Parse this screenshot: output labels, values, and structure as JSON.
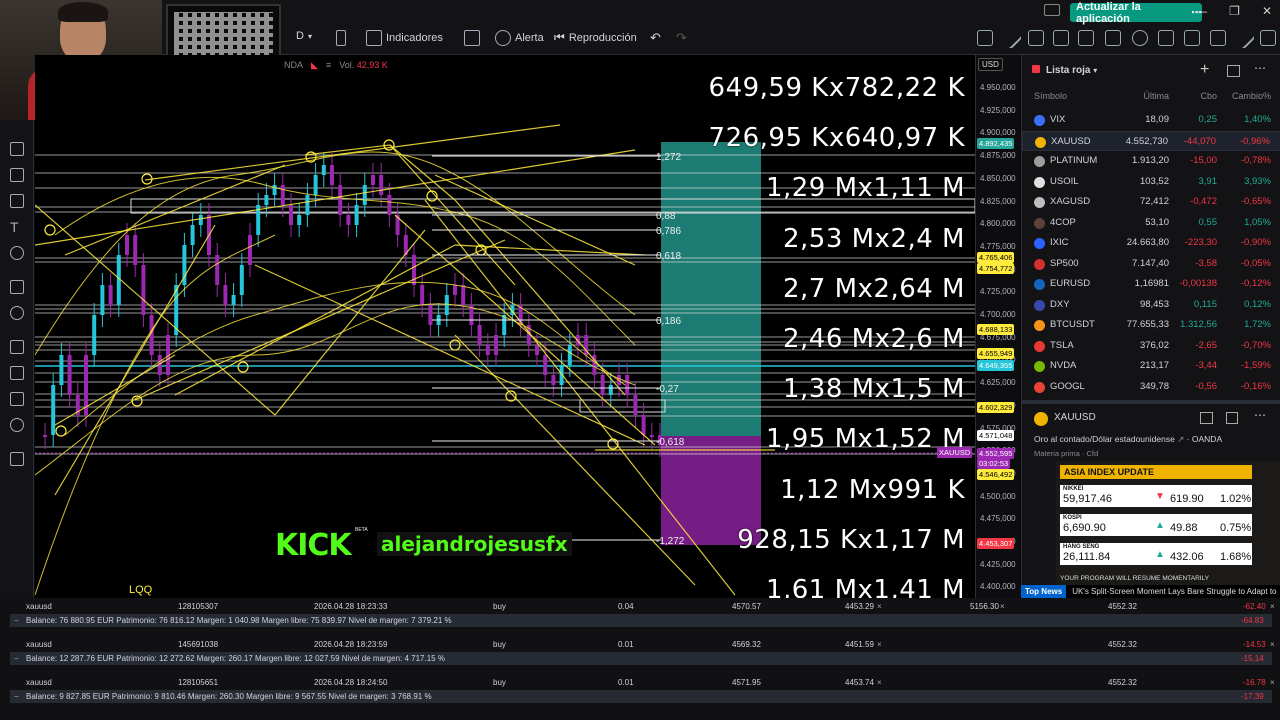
{
  "topbar": {
    "interval": "D",
    "indicators": "Indicadores",
    "alert": "Alerta",
    "replay": "Reproducción",
    "update_button": "Actualizar la aplicación"
  },
  "chart_header": {
    "broker": "NDA",
    "volume_label": "Vol.",
    "volume_value": "42,93 K"
  },
  "chart": {
    "fib_levels": [
      "1,272",
      "0,88",
      "0,786",
      "0,618",
      "0,186",
      "-0,27",
      "-0,618",
      "-1,272"
    ],
    "position_labels": [
      "649,59 Kx782,22 K",
      "726,95 Kx640,97 K",
      "1,29 Mx1,11 M",
      "2,53 Mx2,4 M",
      "2,7 Mx2,64 M",
      "2,46 Mx2,6 M",
      "1,38 Mx1,5 M",
      "1,95 Mx1,52 M",
      "1,12 Mx991 K",
      "928,15 Kx1,17 M",
      "1,61 Mx1,41 M"
    ],
    "kick_logo": "KICK",
    "kick_beta": "BETA",
    "kick_user": "alejandrojesusfx",
    "bottom_label": "LQQ"
  },
  "price_axis": {
    "currency": "USD",
    "ticks": [
      "4.950,000",
      "4.925,000",
      "4.900,000",
      "4.875,000",
      "4.850,000",
      "4.825,000",
      "4.800,000",
      "4.775,000",
      "4.750,000",
      "4.725,000",
      "4.700,000",
      "4.675,000",
      "4.650,000",
      "4.625,000",
      "4.600,000",
      "4.575,000",
      "4.550,000",
      "4.525,000",
      "4.500,000",
      "4.475,000",
      "4.450,000",
      "4.425,000",
      "4.400,000"
    ],
    "tags": {
      "t1": "4.892,435",
      "t2": "4.765,406",
      "t3": "4.754,772",
      "t4": "4.688,133",
      "t5": "4.655,949",
      "t6": "4.649,355",
      "t7": "4.602,329",
      "t8": "4.571,048",
      "t9": "4.552,595",
      "t9b": "03:02:53",
      "t10": "4.546,492",
      "t11": "4.453,307",
      "xau": "XAUUSD"
    }
  },
  "watchlist": {
    "title": "Lista roja",
    "headers": {
      "symbol": "Símbolo",
      "last": "Última",
      "chg": "Cbo",
      "pct": "Cambio%"
    },
    "rows": [
      {
        "sym": "VIX",
        "last": "18,09",
        "chg": "0,25",
        "pct": "1,40%",
        "dir": "pos",
        "color": "#3a6ff7"
      },
      {
        "sym": "XAUUSD",
        "last": "4.552,730",
        "chg": "-44,070",
        "pct": "-0,96%",
        "dir": "neg",
        "color": "#f0b400"
      },
      {
        "sym": "PLATINUM",
        "last": "1.913,20",
        "chg": "-15,00",
        "pct": "-0,78%",
        "dir": "neg",
        "color": "#9e9e9e"
      },
      {
        "sym": "USOIL",
        "last": "103,52",
        "chg": "3,91",
        "pct": "3,93%",
        "dir": "pos",
        "color": "#e0e0e0"
      },
      {
        "sym": "XAGUSD",
        "last": "72,412",
        "chg": "-0,472",
        "pct": "-0,65%",
        "dir": "neg",
        "color": "#bdbdbd"
      },
      {
        "sym": "4COP",
        "last": "53,10",
        "chg": "0,55",
        "pct": "1,05%",
        "dir": "pos",
        "color": "#5d4037"
      },
      {
        "sym": "IXIC",
        "last": "24.663,80",
        "chg": "-223,30",
        "pct": "-0,90%",
        "dir": "neg",
        "color": "#2962ff"
      },
      {
        "sym": "SP500",
        "last": "7.147,40",
        "chg": "-3,58",
        "pct": "-0,05%",
        "dir": "neg",
        "color": "#d32f2f"
      },
      {
        "sym": "EURUSD",
        "last": "1,16981",
        "chg": "-0,00138",
        "pct": "-0,12%",
        "dir": "neg",
        "color": "#1565c0"
      },
      {
        "sym": "DXY",
        "last": "98,453",
        "chg": "0,115",
        "pct": "0,12%",
        "dir": "pos",
        "color": "#3949ab"
      },
      {
        "sym": "BTCUSDT",
        "last": "77.655,33",
        "chg": "1.312,56",
        "pct": "1,72%",
        "dir": "pos",
        "color": "#f7931a"
      },
      {
        "sym": "TSLA",
        "last": "376,02",
        "chg": "-2,65",
        "pct": "-0,70%",
        "dir": "neg",
        "color": "#e53935"
      },
      {
        "sym": "NVDA",
        "last": "213,17",
        "chg": "-3,44",
        "pct": "-1,59%",
        "dir": "neg",
        "color": "#76b900"
      },
      {
        "sym": "GOOGL",
        "last": "349,78",
        "chg": "-0,56",
        "pct": "-0,16%",
        "dir": "neg",
        "color": "#ea4335"
      }
    ]
  },
  "detail": {
    "symbol": "XAUUSD",
    "description": "Oro al contado/Dólar estadounidense",
    "broker": "OANDA",
    "type": "Materia prima · Cfd"
  },
  "asia": {
    "title": "ASIA INDEX UPDATE",
    "rows": [
      {
        "name": "NIKKEI",
        "value": "59,917.46",
        "arrow": "▼",
        "delta": "619.90",
        "pct": "1.02%",
        "dir": "neg"
      },
      {
        "name": "KOSPI",
        "value": "6,690.90",
        "arrow": "▲",
        "delta": "49.88",
        "pct": "0.75%",
        "dir": "pos"
      },
      {
        "name": "HANG SENG",
        "value": "26,111.84",
        "arrow": "▲",
        "delta": "432.06",
        "pct": "1.68%",
        "dir": "pos"
      }
    ],
    "footer": "YOUR PROGRAM WILL RESUME MOMENTARILY"
  },
  "news": {
    "tag": "Top News",
    "text": "UK's Split-Screen Moment Lays Bare Struggle to Adapt to"
  },
  "trades": [
    {
      "symbol": "xauusd",
      "ticket": "128105307",
      "time": "2026.04.28 18:23:33",
      "type": "buy",
      "volume": "0.04",
      "open": "4570.57",
      "sl": "4453.29",
      "tp": "5156.30",
      "price": "4552.32",
      "profit": "-62.40",
      "balance": "Balance: 76 880.95 EUR  Patrimonio: 76 816.12  Margen: 1 040.98  Margen libre: 75 839.97  Nivel de margen: 7 379.21 %",
      "total": "-64.83"
    },
    {
      "symbol": "xauusd",
      "ticket": "145691038",
      "time": "2026.04.28 18:23:59",
      "type": "buy",
      "volume": "0.01",
      "open": "4569.32",
      "sl": "4451.59",
      "tp": "",
      "price": "4552.32",
      "profit": "-14.53",
      "balance": "Balance: 12 287.76 EUR  Patrimonio: 12 272.62  Margen: 260.17  Margen libre: 12 027.59  Nivel de margen: 4 717.15 %",
      "total": "-15.14"
    },
    {
      "symbol": "xauusd",
      "ticket": "128105651",
      "time": "2026.04.28 18:24:50",
      "type": "buy",
      "volume": "0.01",
      "open": "4571.95",
      "sl": "4453.74",
      "tp": "",
      "price": "4552.32",
      "profit": "-16.78",
      "balance": "Balance: 9 827.85 EUR  Patrimonio: 9 810.46  Margen: 260.30  Margen libre: 9 567.55  Nivel de margen: 3 768.91 %",
      "total": "-17.39"
    }
  ]
}
